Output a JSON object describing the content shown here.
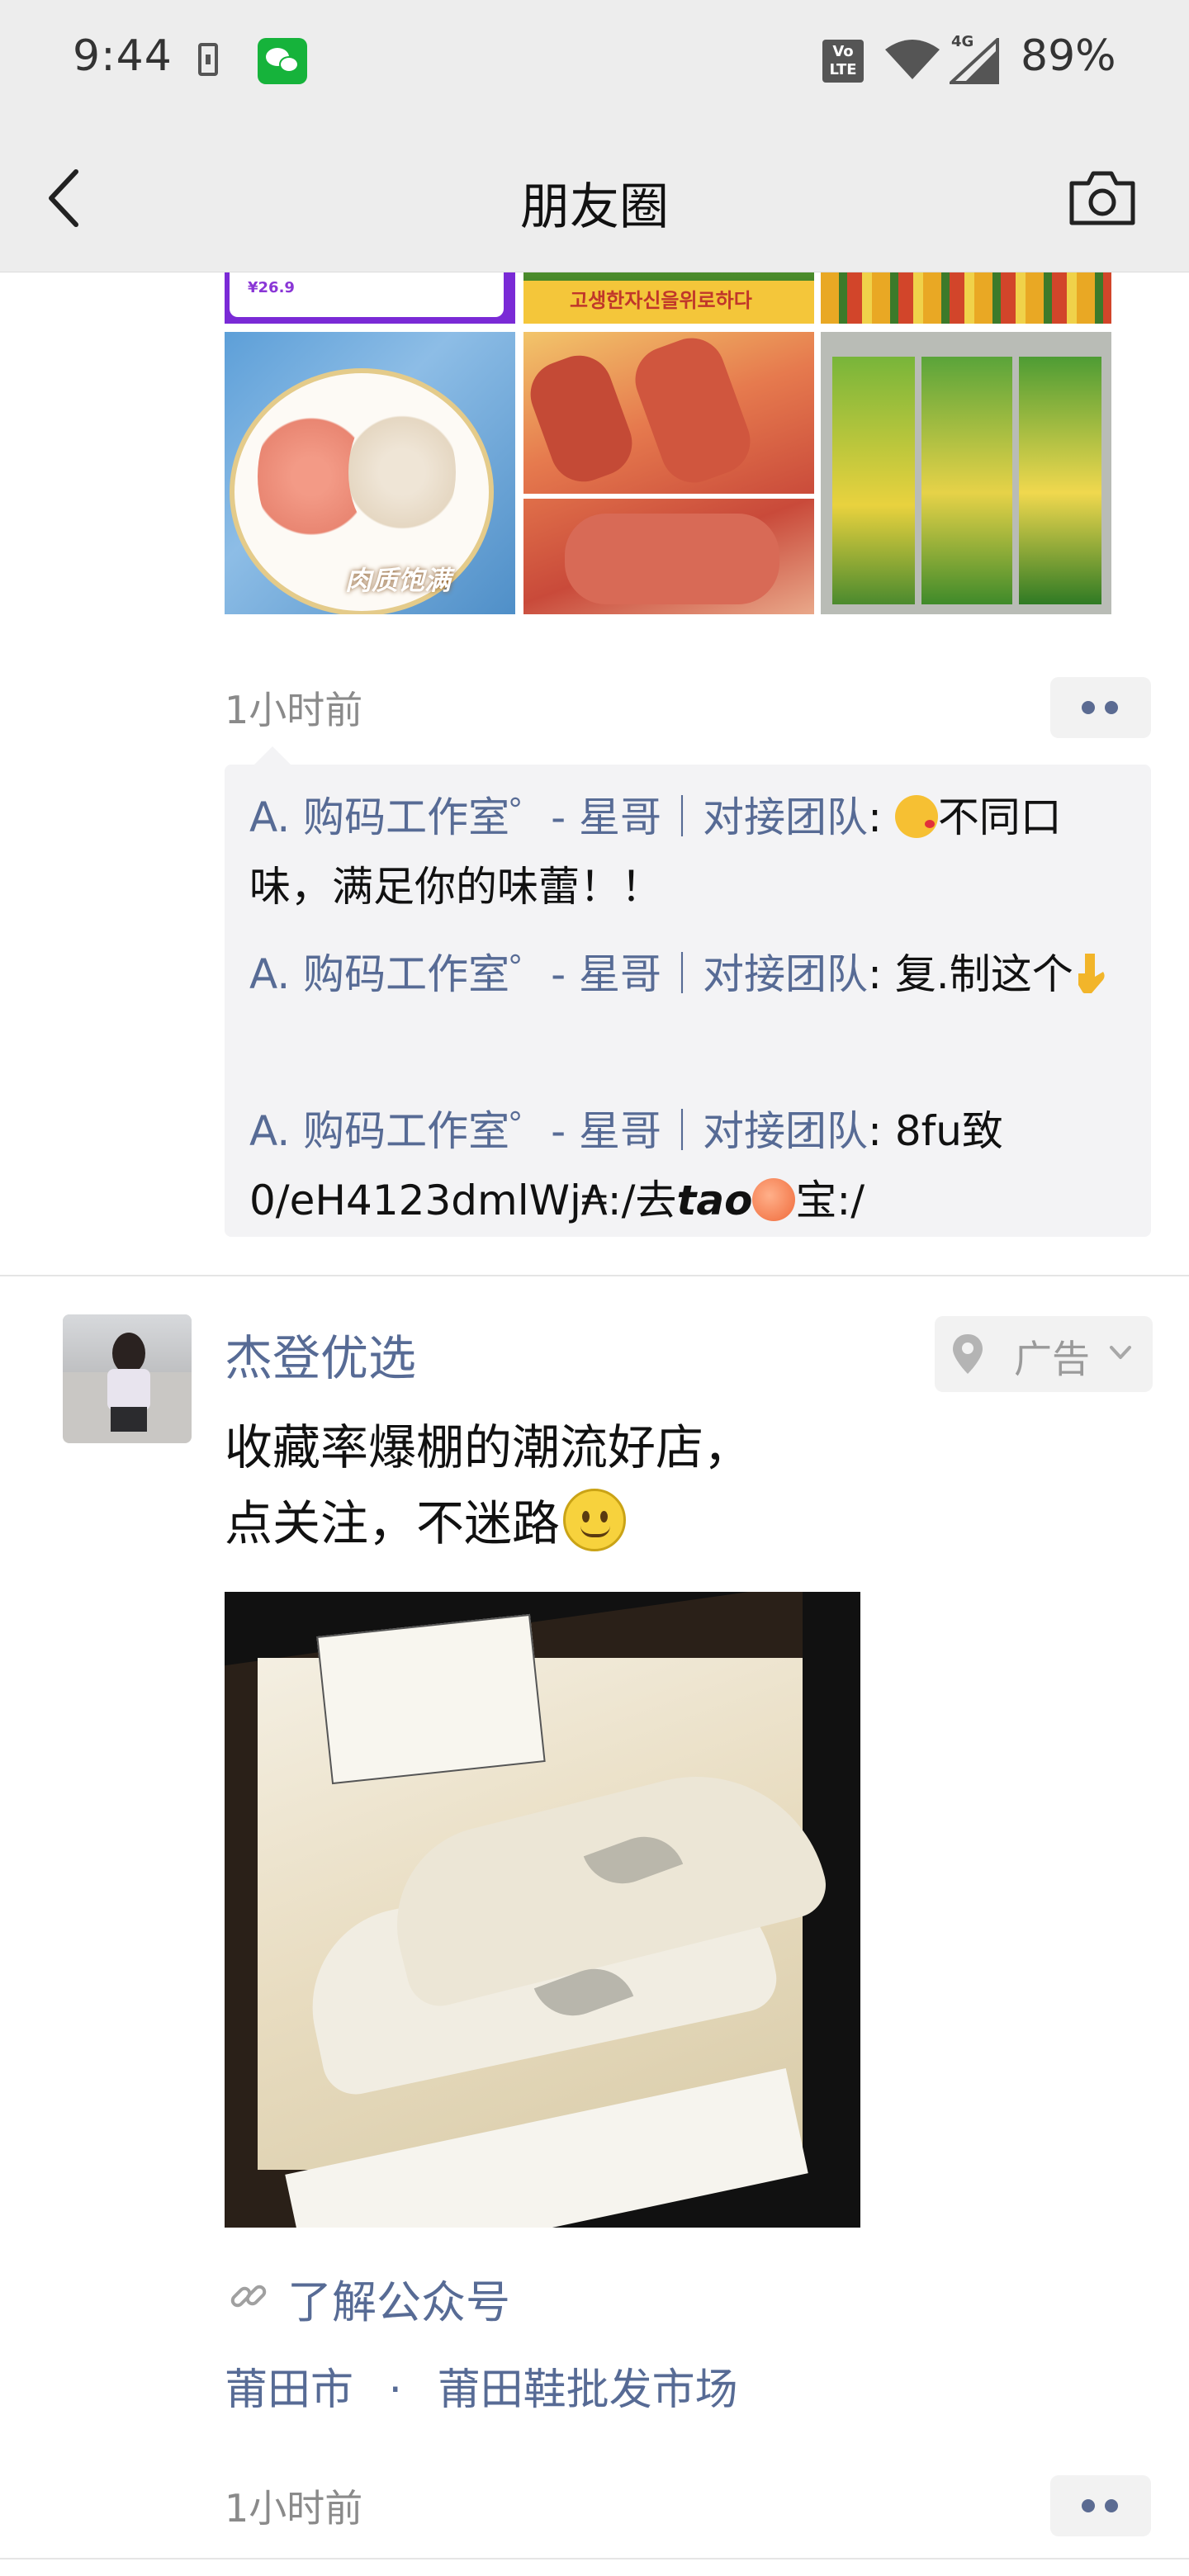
{
  "status_bar": {
    "time": "9:44",
    "network_label": "4G",
    "volte_label": "Vo LTE",
    "battery": "89%"
  },
  "nav": {
    "title": "朋友圈",
    "back_icon": "chevron-left-icon",
    "camera_icon": "camera-icon"
  },
  "post1": {
    "photos": [
      "sausage-promo-banner",
      "korean-text-banner",
      "sausage-sticks",
      "sliced-sausage-plate",
      "grilled-sausages",
      "packaged-ham-sausage"
    ],
    "photo_captions": {
      "price": "¥26.9",
      "plate_caption": "肉质饱满",
      "korean_banner": "고생한자신을위로하다"
    },
    "time": "1小时前",
    "comments": [
      {
        "name": "A. 购码工作室゜- 星哥｜对接团队",
        "sep": ": ",
        "pre": "",
        "post": "不同口味，满足你的味蕾！！",
        "emoji": "kissing-face-emoji"
      },
      {
        "name": "A. 购码工作室゜- 星哥｜对接团队",
        "sep": ": ",
        "pre": "复.制这个",
        "post": "",
        "emoji": "pointing-down-emoji"
      },
      {
        "name": "A. 购码工作室゜- 星哥｜对接团队",
        "sep": ": ",
        "pre": "8fu致0/eH4123dmlWj₳:/去",
        "bold": "tao",
        "post": "宝:/",
        "emoji": "peach-emoji"
      }
    ]
  },
  "post2": {
    "author": "杰登优选",
    "ad_label": "广告",
    "text_line1": "收藏率爆棚的潮流好店，",
    "text_line2": "点关注，不迷路",
    "text_emoji": "smiling-face-emoji",
    "image": "sneakers-in-box-photo",
    "link_text": "了解公众号",
    "location_city": "莆田市",
    "location_dot": "·",
    "location_place": "莆田鞋批发市场",
    "time": "1小时前"
  },
  "colors": {
    "name_blue": "#576b95",
    "bar_bg": "#ededed",
    "comment_bg": "#f3f3f5",
    "time_gray": "#8a8a8a"
  }
}
